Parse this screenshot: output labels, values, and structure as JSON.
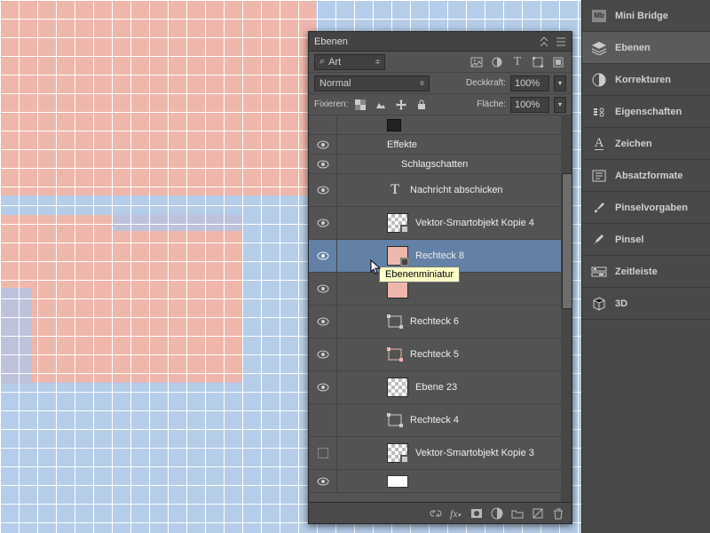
{
  "panel": {
    "title": "Ebenen",
    "filter_label": "Art",
    "blend_mode": "Normal",
    "opacity_label": "Deckkraft:",
    "opacity_value": "100%",
    "lock_label": "Fixieren:",
    "fill_label": "Fläche:",
    "fill_value": "100%"
  },
  "layers": {
    "fx_title": "Effekte",
    "fx_drop": "Schlagschatten",
    "l1": "Nachricht abschicken",
    "l2": "Vektor-Smartobjekt Kopie 4",
    "l3": "Rechteck 8",
    "l4_tooltip": "Ebenenminiatur",
    "l5": "Rechteck 6",
    "l6": "Rechteck 5",
    "l7": "Ebene 23",
    "l8": "Rechteck 4",
    "l9": "Vektor-Smartobjekt Kopie 3"
  },
  "sidebar": {
    "s0": "Mini Bridge",
    "s1": "Ebenen",
    "s2": "Korrekturen",
    "s3": "Eigenschaften",
    "s4": "Zeichen",
    "s5": "Absatzformate",
    "s6": "Pinselvorgaben",
    "s7": "Pinsel",
    "s8": "Zeitleiste",
    "s9": "3D"
  }
}
